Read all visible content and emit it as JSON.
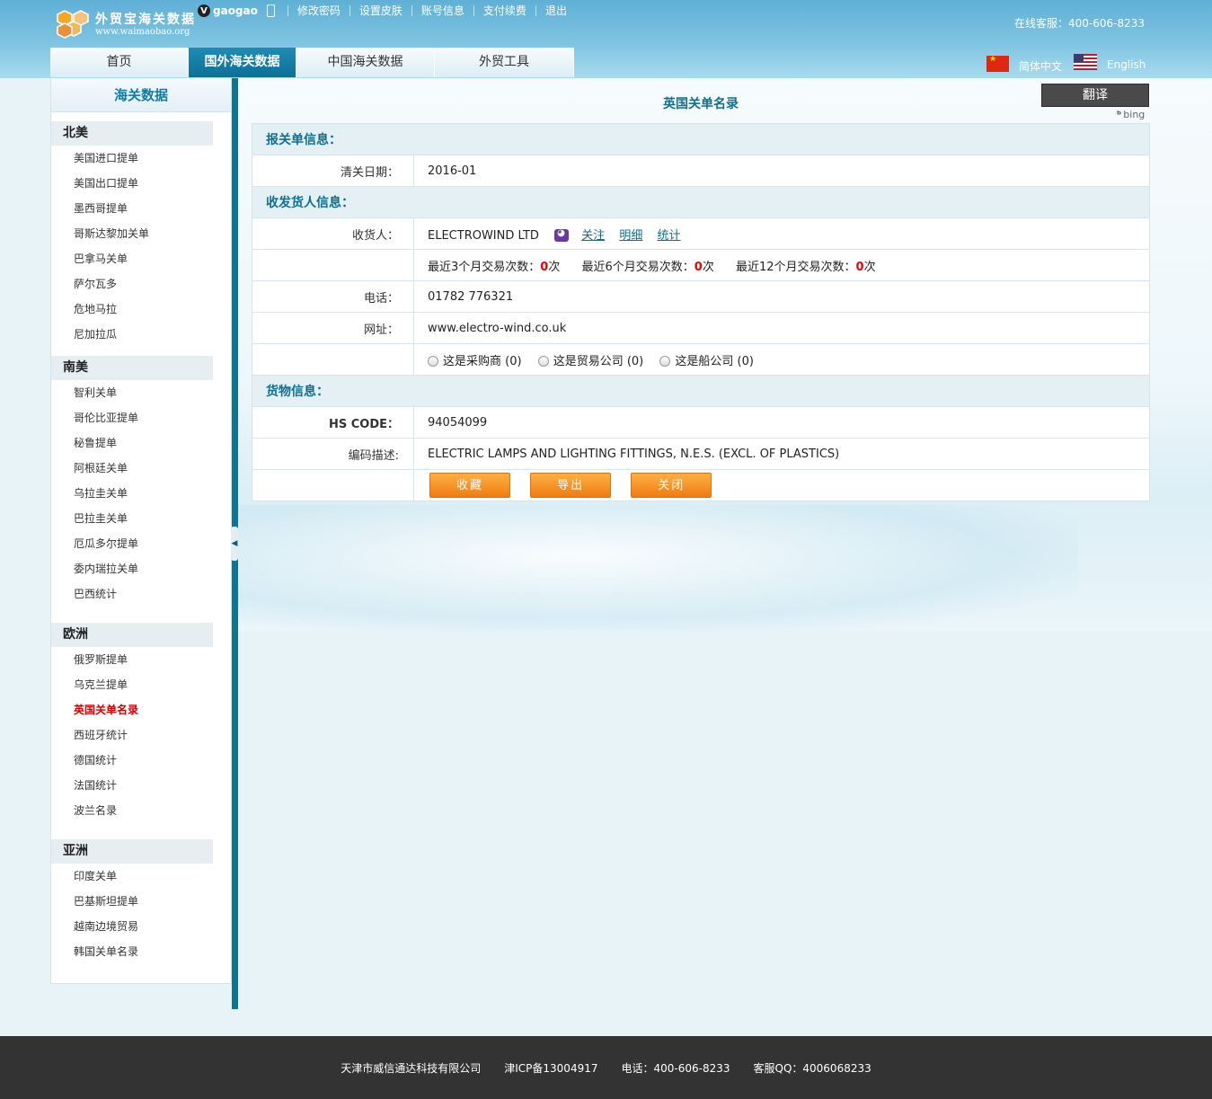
{
  "header": {
    "logo_title": "外贸宝海关数据",
    "logo_url": "www.waimaobao.org",
    "user_badge": "V",
    "username": "gaogao",
    "links": [
      "修改密码",
      "设置皮肤",
      "账号信息",
      "支付续费",
      "退出"
    ],
    "hotline": "在线客服：400-606-8233",
    "lang_cn": "简体中文",
    "lang_en": "English"
  },
  "nav": {
    "tabs": [
      "首页",
      "国外海关数据",
      "中国海关数据",
      "外贸工具"
    ]
  },
  "sidebar": {
    "title": "海关数据",
    "regions": [
      {
        "name": "北美",
        "items": [
          "美国进口提单",
          "美国出口提单",
          "墨西哥提单",
          "哥斯达黎加关单",
          "巴拿马关单",
          "萨尔瓦多",
          "危地马拉",
          "尼加拉瓜"
        ]
      },
      {
        "name": "南美",
        "items": [
          "智利关单",
          "哥伦比亚提单",
          "秘鲁提单",
          "阿根廷关单",
          "乌拉圭关单",
          "巴拉圭关单",
          "厄瓜多尔提单",
          "委内瑞拉关单",
          "巴西统计"
        ]
      },
      {
        "name": "欧洲",
        "items": [
          "俄罗斯提单",
          "乌克兰提单",
          "英国关单名录",
          "西班牙统计",
          "德国统计",
          "法国统计",
          "波兰名录"
        ]
      },
      {
        "name": "亚洲",
        "items": [
          "印度关单",
          "巴基斯坦提单",
          "越南边境贸易",
          "韩国关单名录"
        ]
      }
    ]
  },
  "main": {
    "page_title": "英国关单名录",
    "translate_label": "翻译",
    "bing_label": "bing",
    "section_customs": "报关单信息：",
    "clear_date_label": "清关日期：",
    "clear_date": "2016-01",
    "section_parties": "收发货人信息：",
    "consignee_label": "收货人：",
    "consignee": "ELECTROWIND LTD",
    "link_follow": "关注",
    "link_detail": "明细",
    "link_stats": "统计",
    "stat3_label": "最近3个月交易次数：",
    "stat3_value": "0",
    "stat6_label": "最近6个月交易次数：",
    "stat6_value": "0",
    "stat12_label": "最近12个月交易次数：",
    "stat12_value": "0",
    "times_unit": "次",
    "phone_label": "电话：",
    "phone": "01782 776321",
    "website_label": "网址：",
    "website": "www.electro-wind.co.uk",
    "radio_buyer": "这是采购商 (0)",
    "radio_trader": "这是贸易公司 (0)",
    "radio_shipper": "这是船公司 (0)",
    "section_goods": "货物信息：",
    "hs_label": "HS CODE：",
    "hs_code": "94054099",
    "desc_label": "编码描述:",
    "desc": "ELECTRIC LAMPS AND LIGHTING FITTINGS, N.E.S. (EXCL. OF PLASTICS)",
    "btn_collect": "收藏",
    "btn_export": "导出",
    "btn_close": "关闭"
  },
  "footer": {
    "company": "天津市威信通达科技有限公司",
    "icp": "津ICP备13004917",
    "phone": "电话：400-606-8233",
    "qq": "客服QQ：4006068233"
  },
  "colors": {
    "accent": "#0f6f8f",
    "button": "#f39420",
    "active_item": "#d60000"
  }
}
